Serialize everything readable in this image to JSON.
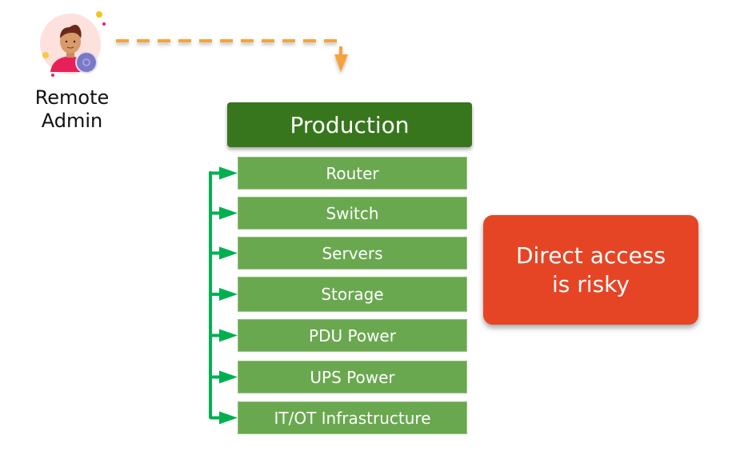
{
  "actor": {
    "label_line1": "Remote",
    "label_line2": "Admin",
    "avatar_icon": "person-with-gear-badge-icon"
  },
  "production": {
    "title": "Production",
    "color": "#38761d",
    "items": [
      {
        "label": "Router"
      },
      {
        "label": "Switch"
      },
      {
        "label": "Servers"
      },
      {
        "label": "Storage"
      },
      {
        "label": "PDU Power"
      },
      {
        "label": "UPS Power"
      },
      {
        "label": "IT/OT  Infrastructure"
      }
    ],
    "item_color": "#6aa84f",
    "connector_color": "#00b050"
  },
  "warning": {
    "line1": "Direct access",
    "line2": "is risky",
    "color": "#e64525"
  },
  "access_arrow": {
    "style": "dashed",
    "color": "#f6a33c"
  }
}
